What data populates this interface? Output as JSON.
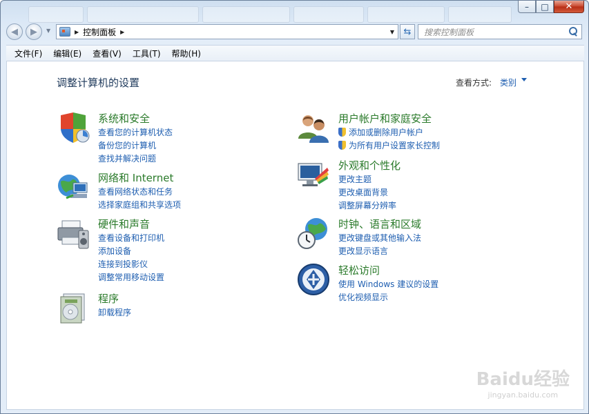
{
  "window": {
    "minimize_glyph": "–",
    "maximize_glyph": "□",
    "close_glyph": "✕"
  },
  "nav": {
    "back_glyph": "◀",
    "forward_glyph": "▶",
    "breadcrumb": "控制面板",
    "search_placeholder": "搜索控制面板"
  },
  "menu": [
    "文件(F)",
    "编辑(E)",
    "查看(V)",
    "工具(T)",
    "帮助(H)"
  ],
  "main": {
    "title": "调整计算机的设置",
    "view_label": "查看方式:",
    "view_value": "类别"
  },
  "categories": [
    {
      "title": "系统和安全",
      "icon": "system-security-icon",
      "links": [
        "查看您的计算机状态",
        "备份您的计算机",
        "查找并解决问题"
      ]
    },
    {
      "title": "网络和 Internet",
      "icon": "network-internet-icon",
      "links": [
        "查看网络状态和任务",
        "选择家庭组和共享选项"
      ]
    },
    {
      "title": "硬件和声音",
      "icon": "hardware-sound-icon",
      "links": [
        "查看设备和打印机",
        "添加设备",
        "连接到投影仪",
        "调整常用移动设置"
      ]
    },
    {
      "title": "程序",
      "icon": "programs-icon",
      "links": [
        "卸载程序"
      ]
    },
    {
      "title": "用户帐户和家庭安全",
      "icon": "user-accounts-icon",
      "links": [
        "添加或删除用户帐户",
        "为所有用户设置家长控制"
      ]
    },
    {
      "title": "外观和个性化",
      "icon": "appearance-icon",
      "links": [
        "更改主题",
        "更改桌面背景",
        "调整屏幕分辨率"
      ]
    },
    {
      "title": "时钟、语言和区域",
      "icon": "clock-language-icon",
      "links": [
        "更改键盘或其他输入法",
        "更改显示语言"
      ]
    },
    {
      "title": "轻松访问",
      "icon": "ease-of-access-icon",
      "links": [
        "使用 Windows 建议的设置",
        "优化视频显示"
      ]
    }
  ],
  "watermark": {
    "brand": "Baidu经验",
    "url": "jingyan.baidu.com"
  },
  "colors": {
    "category_title": "#2a7a2a",
    "link": "#1e5eb0",
    "close_button": "#c8462c"
  }
}
